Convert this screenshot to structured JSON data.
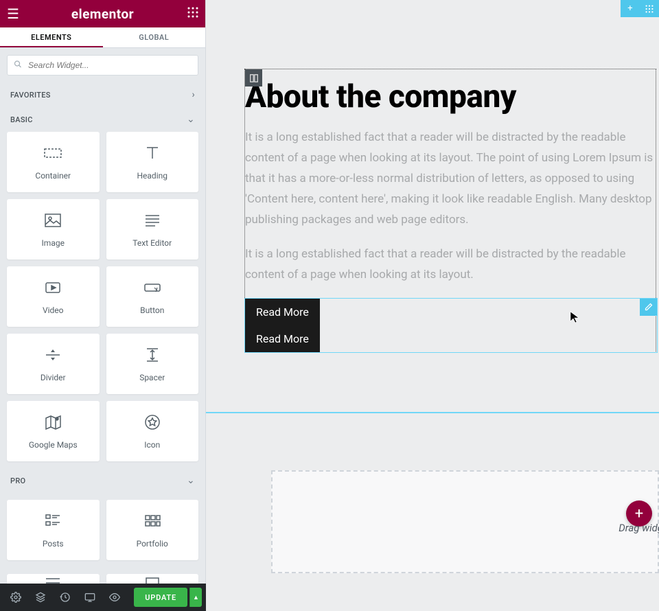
{
  "header": {
    "logo": "elementor"
  },
  "tabs": {
    "elements": "ELEMENTS",
    "global": "GLOBAL"
  },
  "search": {
    "placeholder": "Search Widget..."
  },
  "categories": {
    "favorites": "FAVORITES",
    "basic": "BASIC",
    "pro": "PRO"
  },
  "widgets": {
    "basic": [
      {
        "label": "Container",
        "icon": "container"
      },
      {
        "label": "Heading",
        "icon": "heading"
      },
      {
        "label": "Image",
        "icon": "image"
      },
      {
        "label": "Text Editor",
        "icon": "text"
      },
      {
        "label": "Video",
        "icon": "video"
      },
      {
        "label": "Button",
        "icon": "button"
      },
      {
        "label": "Divider",
        "icon": "divider"
      },
      {
        "label": "Spacer",
        "icon": "spacer"
      },
      {
        "label": "Google Maps",
        "icon": "maps"
      },
      {
        "label": "Icon",
        "icon": "icon"
      }
    ],
    "pro": [
      {
        "label": "Posts",
        "icon": "posts"
      },
      {
        "label": "Portfolio",
        "icon": "portfolio"
      }
    ]
  },
  "footer": {
    "update": "UPDATE"
  },
  "page": {
    "heading": "About the company",
    "para1": "It is a long established fact that a reader will be distracted by the readable content of a page when looking at its layout. The point of using Lorem Ipsum is that it has a more-or-less normal distribution of letters, as opposed to using 'Content here, content here', making it look like readable English. Many desktop publishing packages and web page editors.",
    "para2": "It is a long established fact that a reader will be distracted by the readable content of a page when looking at its layout.",
    "button1": "Read More",
    "button2": "Read More",
    "drag_hint": "Drag widg"
  }
}
